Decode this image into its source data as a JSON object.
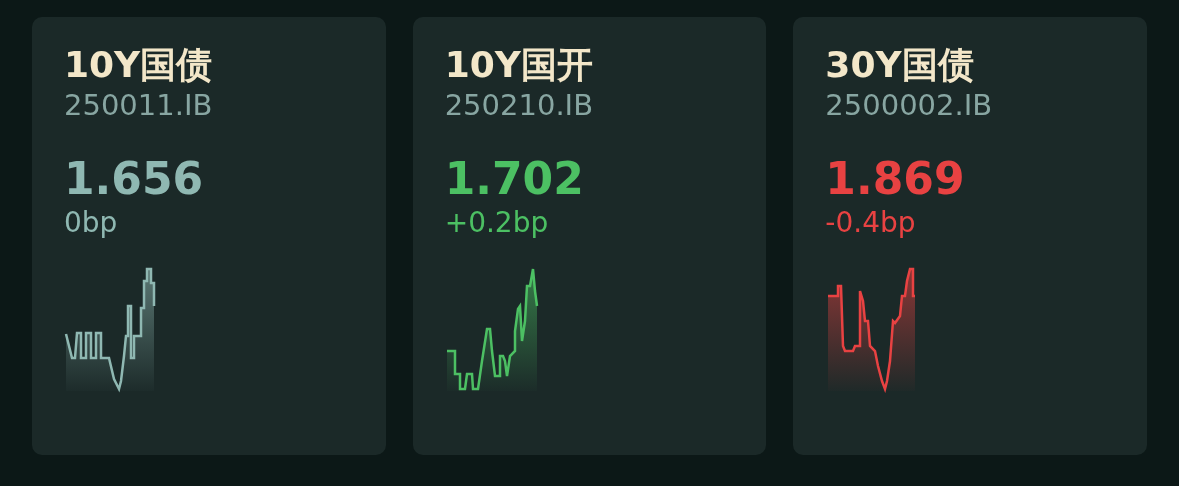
{
  "cards": [
    {
      "title": "10Y国债",
      "code": "250011.IB",
      "value": "1.656",
      "change": "0bp",
      "color": "#8fb8b2"
    },
    {
      "title": "10Y国开",
      "code": "250210.IB",
      "value": "1.702",
      "change": "+0.2bp",
      "color": "#4cc063"
    },
    {
      "title": "30Y国债",
      "code": "2500002.IB",
      "value": "1.869",
      "change": "-0.4bp",
      "color": "#e84242"
    }
  ]
}
